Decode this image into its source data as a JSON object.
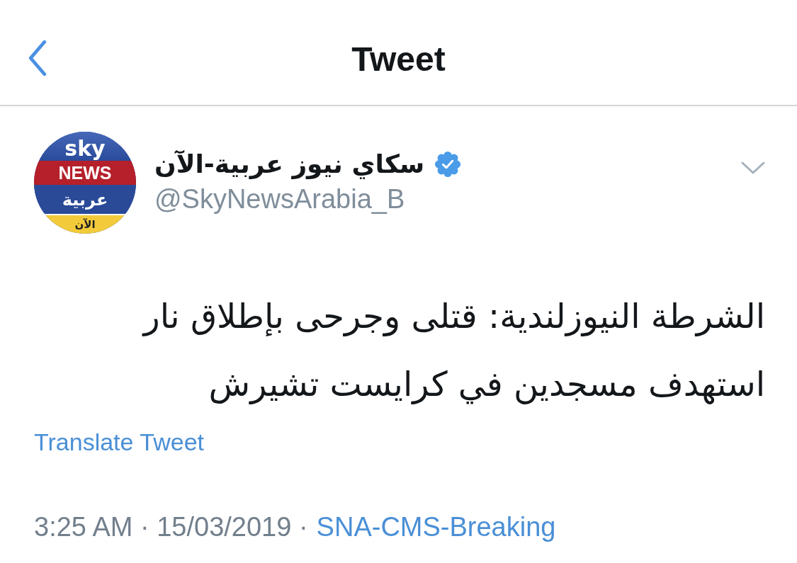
{
  "header": {
    "title": "Tweet"
  },
  "tweet": {
    "author": {
      "avatar_logo": [
        "sky",
        "NEWS",
        "عربية",
        "الآن"
      ],
      "name": "سكاي نيوز عربية-الآن",
      "verified": true,
      "handle": "@SkyNewsArabia_B"
    },
    "text": "الشرطة النيوزلندية: قتلى وجرحى بإطلاق نار استهدف مسجدين في كرايست تشيرش",
    "translate_link": "Translate Tweet",
    "timestamp": "3:25 AM · 15/03/2019 ·",
    "source": "SNA-CMS-Breaking"
  }
}
